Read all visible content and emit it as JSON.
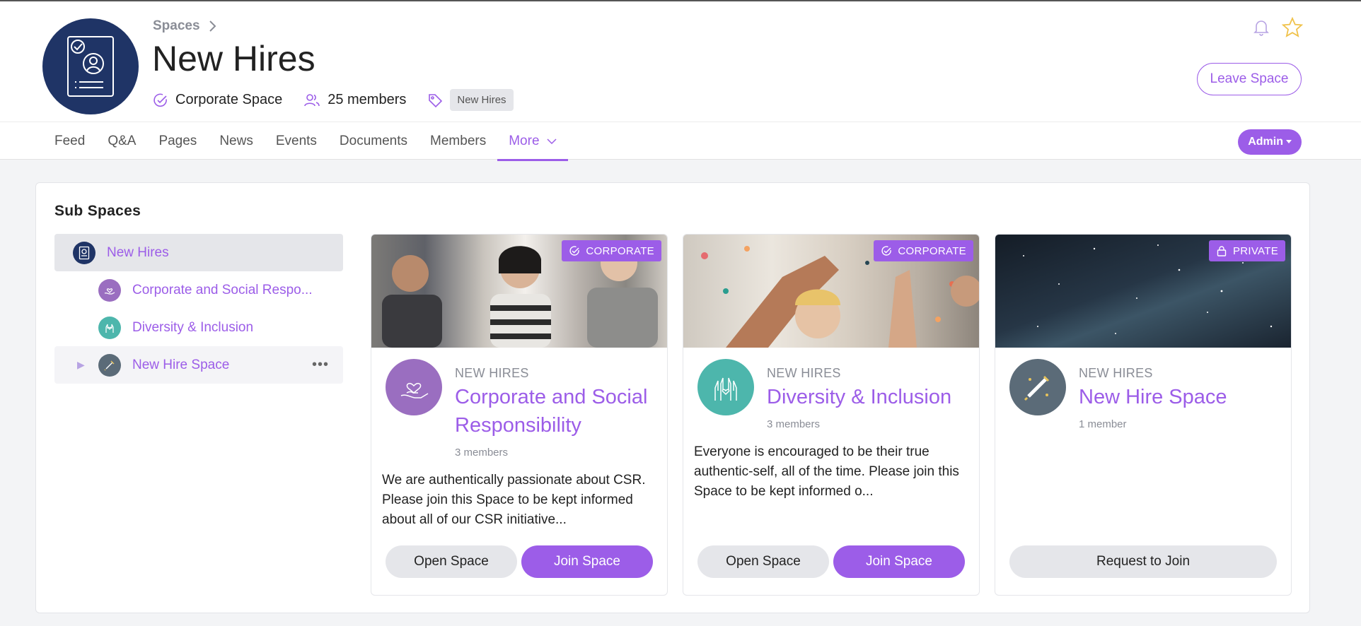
{
  "header": {
    "breadcrumb": "Spaces",
    "title": "New Hires",
    "space_type": "Corporate Space",
    "members": "25 members",
    "tag": "New Hires",
    "leave_label": "Leave Space"
  },
  "nav": {
    "tabs": [
      {
        "label": "Feed"
      },
      {
        "label": "Q&A"
      },
      {
        "label": "Pages"
      },
      {
        "label": "News"
      },
      {
        "label": "Events"
      },
      {
        "label": "Documents"
      },
      {
        "label": "Members"
      },
      {
        "label": "More"
      }
    ],
    "admin_label": "Admin"
  },
  "subspaces": {
    "title": "Sub Spaces",
    "tree": [
      {
        "label": "New Hires"
      },
      {
        "label": "Corporate and Social Respo..."
      },
      {
        "label": "Diversity & Inclusion"
      },
      {
        "label": "New Hire Space"
      }
    ],
    "more_glyph": "•••"
  },
  "cards": [
    {
      "badge": "CORPORATE",
      "parent": "NEW HIRES",
      "title": "Corporate and Social Responsibility",
      "members": "3 members",
      "description": "We are authentically passionate about CSR. Please join this Space to be kept informed about all of our CSR initiative...",
      "open_label": "Open Space",
      "join_label": "Join Space"
    },
    {
      "badge": "CORPORATE",
      "parent": "NEW HIRES",
      "title": "Diversity & Inclusion",
      "members": "3 members",
      "description": "Everyone is encouraged to be their true authentic-self, all of the time. Please join this Space to be kept informed o...",
      "open_label": "Open Space",
      "join_label": "Join Space"
    },
    {
      "badge": "PRIVATE",
      "parent": "NEW HIRES",
      "title": "New Hire Space",
      "members": "1 member",
      "request_label": "Request to Join"
    }
  ],
  "colors": {
    "accent": "#9c5de8",
    "space_navy": "#1f3466",
    "csr_purple": "#9a6ec0",
    "dei_teal": "#4db6ac",
    "rocket_grey": "#5b6b78"
  },
  "icons": {
    "space_avatar": "id-card-icon",
    "verified": "check-circle-icon",
    "members": "users-icon",
    "tag": "tag-icon",
    "notifications": "bell-icon",
    "favorite": "star-icon",
    "private": "lock-icon"
  }
}
